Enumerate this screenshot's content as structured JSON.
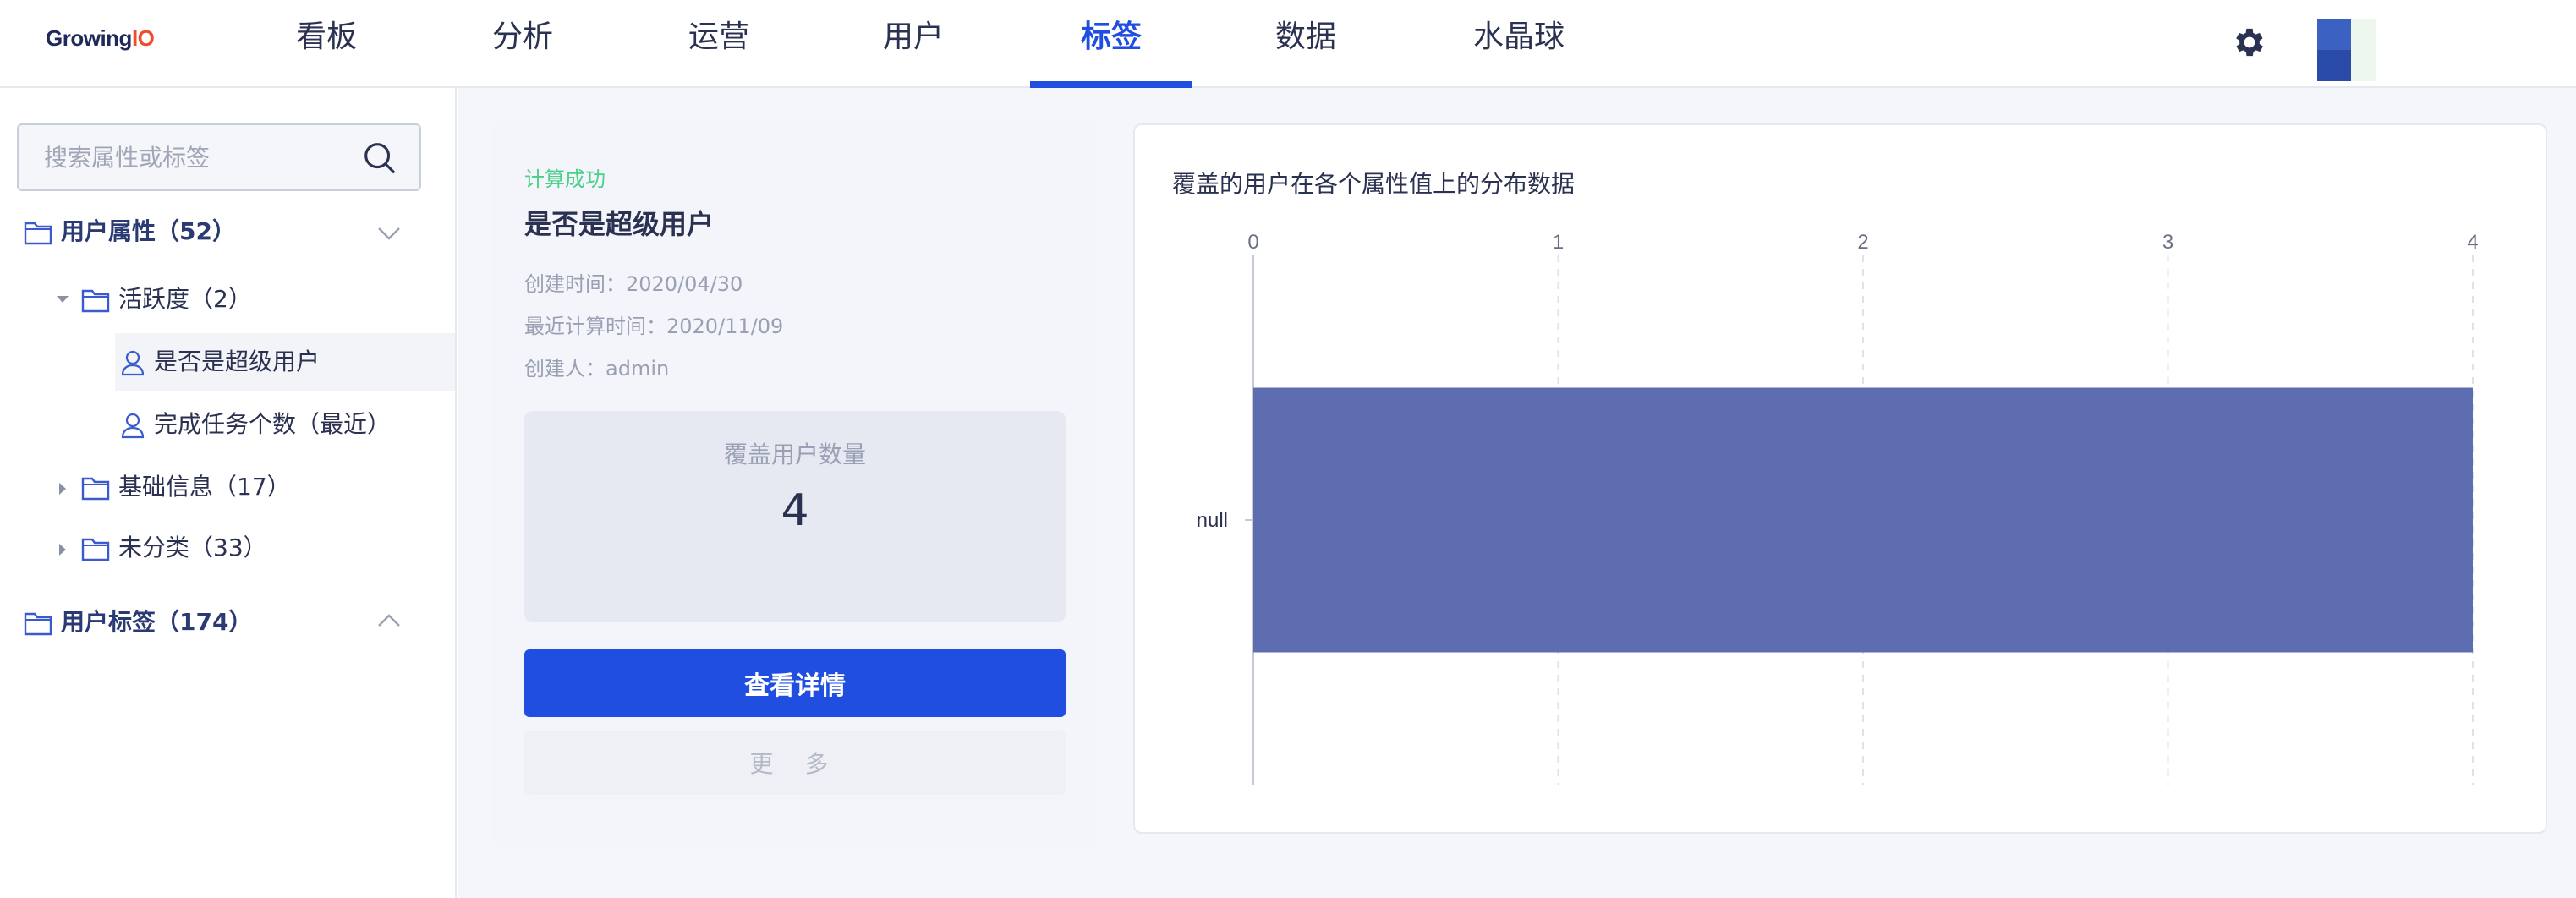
{
  "app": {
    "logo_main": "Growing",
    "logo_io": "IO"
  },
  "nav": {
    "items": [
      {
        "label": "看板"
      },
      {
        "label": "分析"
      },
      {
        "label": "运营"
      },
      {
        "label": "用户"
      },
      {
        "label": "标签"
      },
      {
        "label": "数据"
      },
      {
        "label": "水晶球"
      }
    ],
    "active": "标签"
  },
  "sidebar": {
    "search_placeholder": "搜索属性或标签",
    "tree": {
      "user_attrs": "用户属性（52）",
      "activity": "活跃度（2）",
      "super_user": "是否是超级用户",
      "task_count": "完成任务个数（最近）",
      "basic_info": "基础信息（17）",
      "uncategorized": "未分类（33）",
      "user_tags": "用户标签（174）"
    }
  },
  "detail": {
    "status": "计算成功",
    "title": "是否是超级用户",
    "created_label": "创建时间：",
    "created_value": "2020/04/30",
    "computed_label": "最近计算时间：",
    "computed_value": "2020/11/09",
    "creator_label": "创建人：",
    "creator_value": "admin",
    "cover_label": "覆盖用户数量",
    "cover_value": "4",
    "detail_button": "查看详情",
    "more_button": "更 多"
  },
  "colors": {
    "accent": "#1f4ee0",
    "bar": "#5e6db0",
    "success": "#4ccf8a"
  },
  "chart_data": {
    "type": "bar",
    "orientation": "horizontal",
    "title": "覆盖的用户在各个属性值上的分布数据",
    "categories": [
      "null"
    ],
    "values": [
      4
    ],
    "xlim": [
      0,
      4
    ],
    "xticks": [
      "0",
      "1",
      "2",
      "3",
      "4"
    ],
    "xaxis_position": "top",
    "grid": true
  }
}
